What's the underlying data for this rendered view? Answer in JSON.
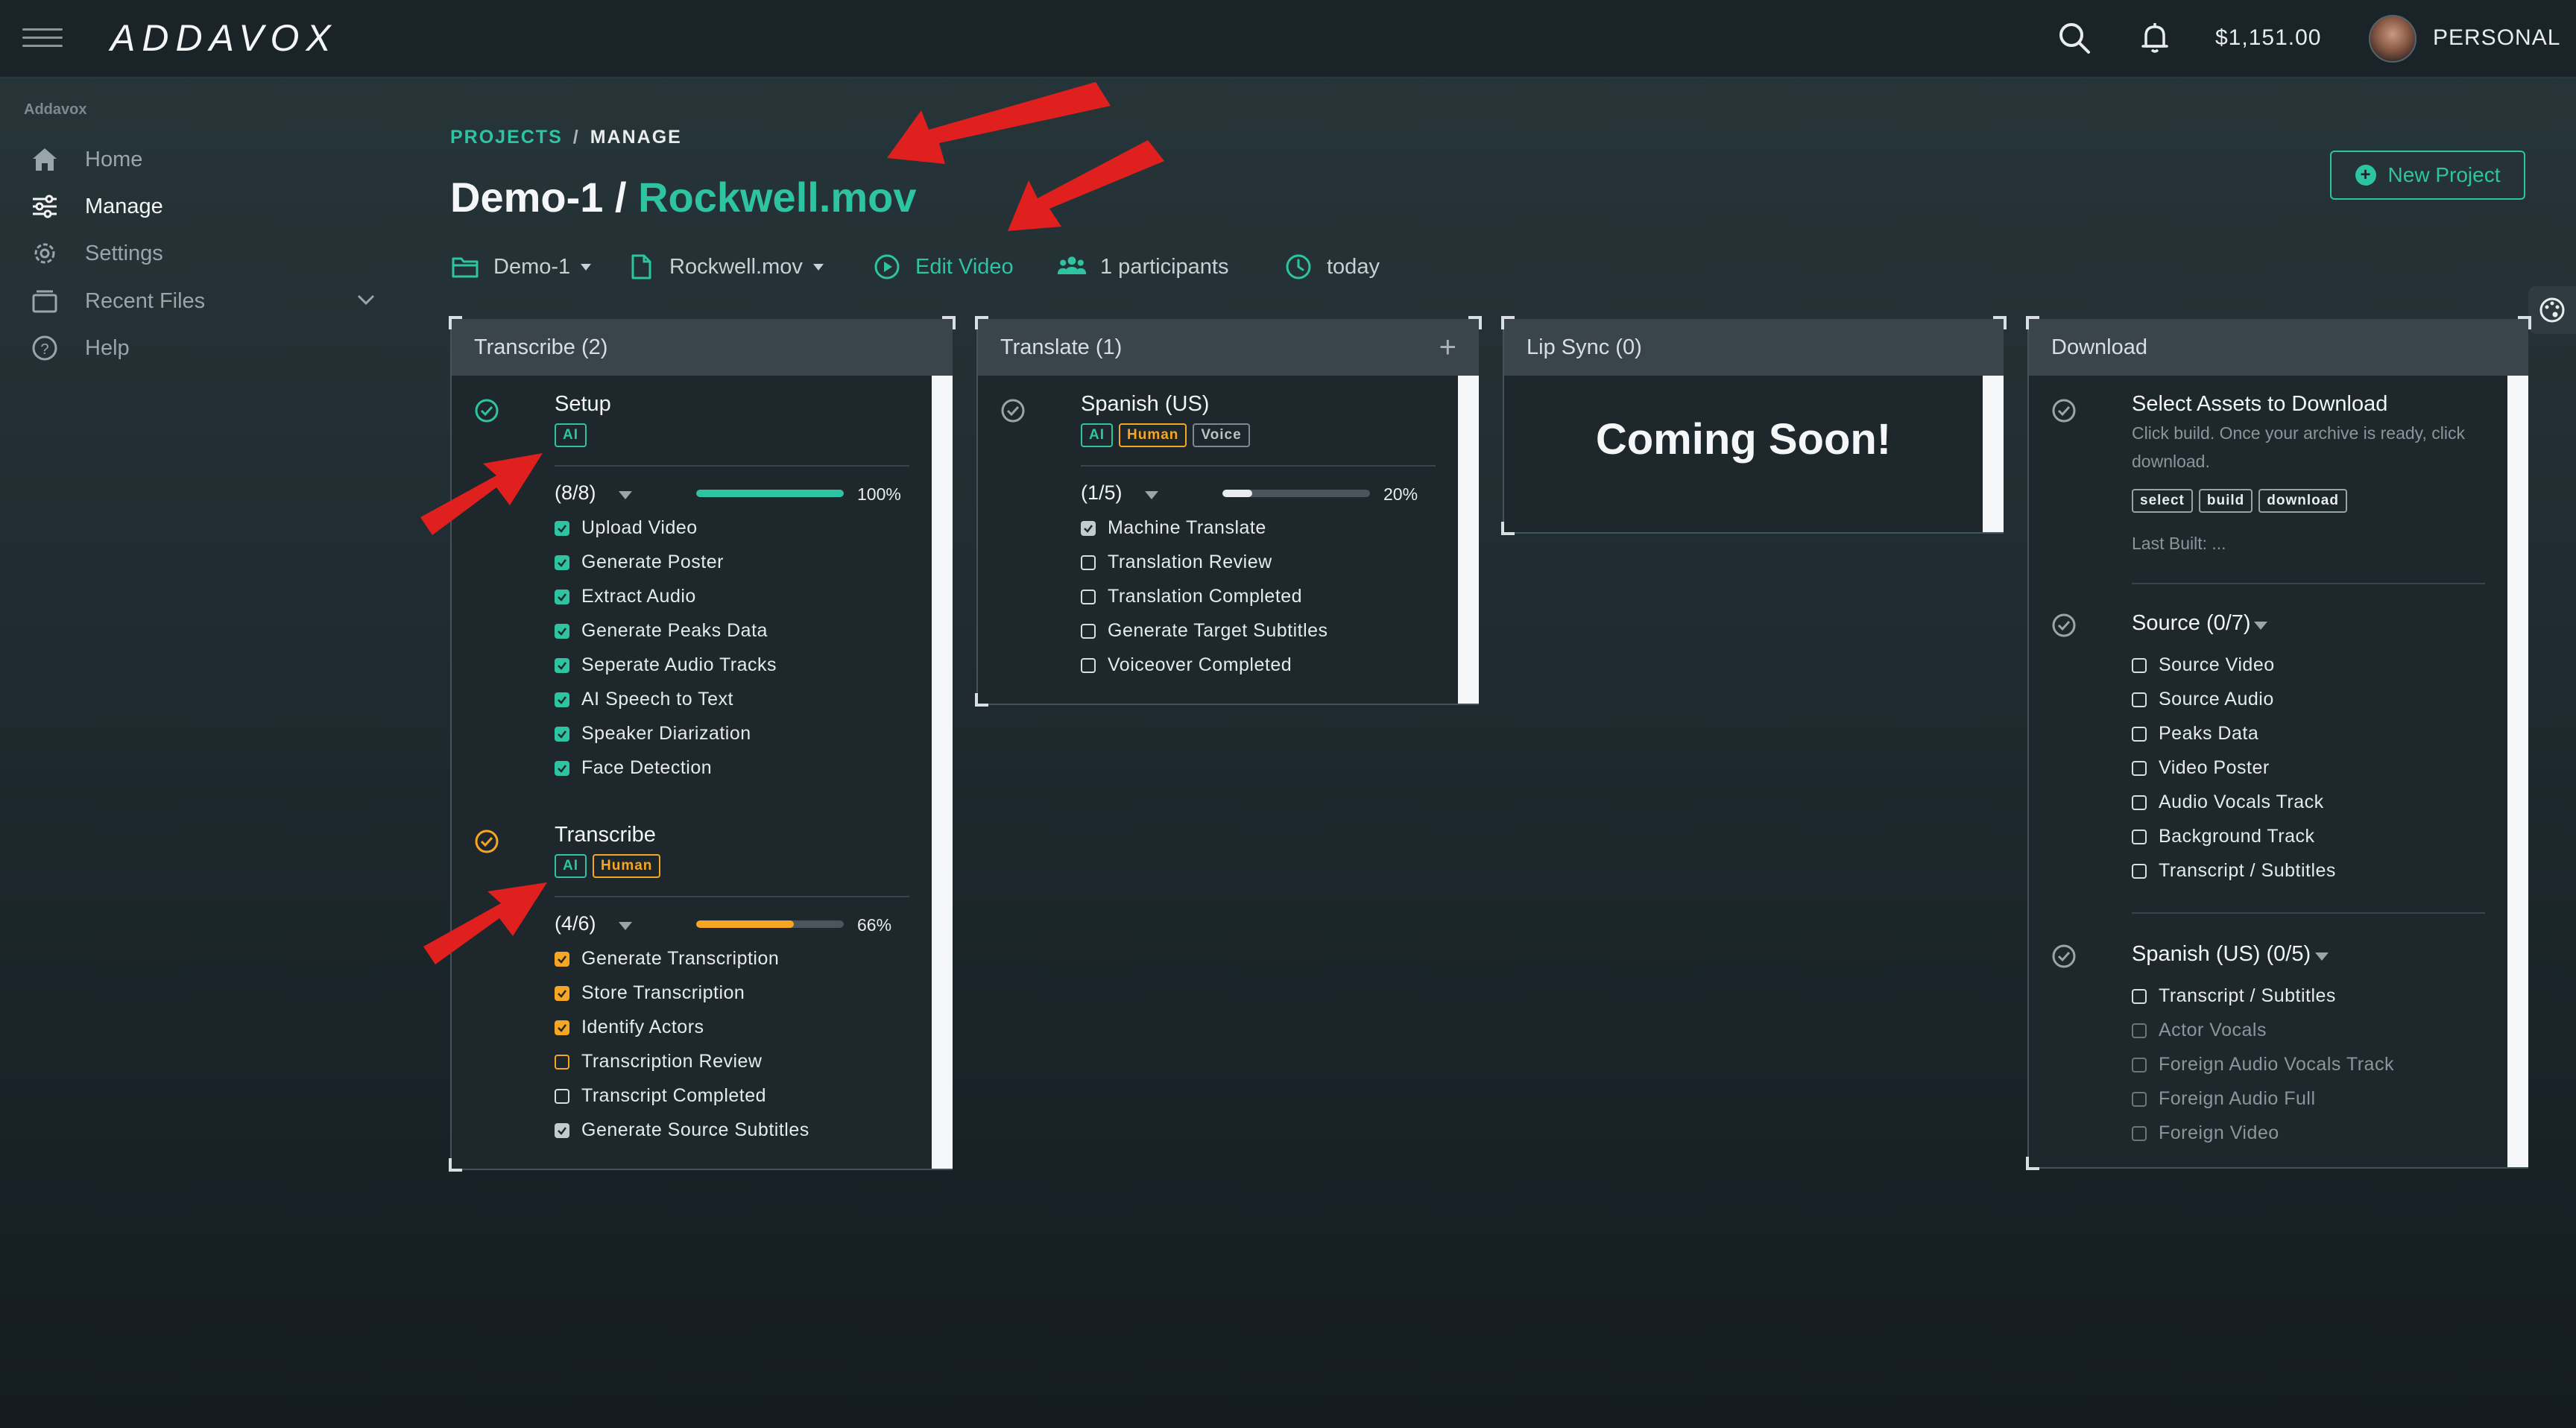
{
  "app": {
    "logo": "ADDAVOX",
    "balance": "$1,151.00",
    "account": "PERSONAL"
  },
  "sidebar": {
    "brand": "Addavox",
    "items": [
      {
        "label": "Home",
        "icon": "home-icon"
      },
      {
        "label": "Manage",
        "icon": "sliders-icon",
        "active": true
      },
      {
        "label": "Settings",
        "icon": "gear-icon"
      },
      {
        "label": "Recent Files",
        "icon": "folder-icon"
      },
      {
        "label": "Help",
        "icon": "help-icon"
      }
    ]
  },
  "breadcrumb": {
    "projects": "PROJECTS",
    "separator": "/",
    "current": "MANAGE"
  },
  "title": {
    "project": "Demo-1 / ",
    "file": "Rockwell.mov"
  },
  "new_project_label": "New Project",
  "meta": {
    "project": "Demo-1",
    "file": "Rockwell.mov",
    "edit": "Edit Video",
    "participants": "1 participants",
    "time": "today"
  },
  "columns": {
    "transcribe": {
      "title": "Transcribe (2)",
      "tasks": [
        {
          "title": "Setup",
          "tags": [
            "AI"
          ],
          "count": "(8/8)",
          "percent": "100%",
          "progress": 1.0,
          "items": [
            "Upload Video",
            "Generate Poster",
            "Extract Audio",
            "Generate Peaks Data",
            "Seperate Audio Tracks",
            "AI Speech to Text",
            "Speaker Diarization",
            "Face Detection"
          ]
        },
        {
          "title": "Transcribe",
          "tags": [
            "AI",
            "Human"
          ],
          "count": "(4/6)",
          "percent": "66%",
          "progress": 0.66,
          "items": [
            "Generate Transcription",
            "Store Transcription",
            "Identify Actors",
            "Transcription Review",
            "Transcript Completed",
            "Generate Source Subtitles"
          ]
        }
      ]
    },
    "translate": {
      "title": "Translate (1)",
      "add": "+",
      "tasks": [
        {
          "title": "Spanish (US)",
          "tags": [
            "AI",
            "Human",
            "Voice"
          ],
          "count": "(1/5)",
          "percent": "20%",
          "progress": 0.2,
          "items": [
            "Machine Translate",
            "Translation Review",
            "Translation Completed",
            "Generate Target Subtitles",
            "Voiceover Completed"
          ]
        }
      ]
    },
    "lipsync": {
      "title": "Lip Sync (0)",
      "message": "Coming Soon!"
    },
    "download": {
      "title": "Download",
      "select": {
        "title": "Select Assets to Download",
        "subtitle": "Click build. Once your archive is ready, click download.",
        "buttons": [
          "select",
          "build",
          "download"
        ],
        "last_built": "Last Built: ..."
      },
      "source": {
        "title": "Source (0/7)",
        "items": [
          "Source Video",
          "Source Audio",
          "Peaks Data",
          "Video Poster",
          "Audio Vocals Track",
          "Background Track",
          "Transcript / Subtitles"
        ]
      },
      "spanish": {
        "title": "Spanish (US) (0/5)",
        "items": [
          "Transcript / Subtitles",
          "Actor Vocals",
          "Foreign Audio Vocals Track",
          "Foreign Audio Full",
          "Foreign Video"
        ]
      }
    }
  },
  "colors": {
    "accent": "#2ec4a1",
    "amber": "#f5a623",
    "annotation": "#e0201e"
  }
}
